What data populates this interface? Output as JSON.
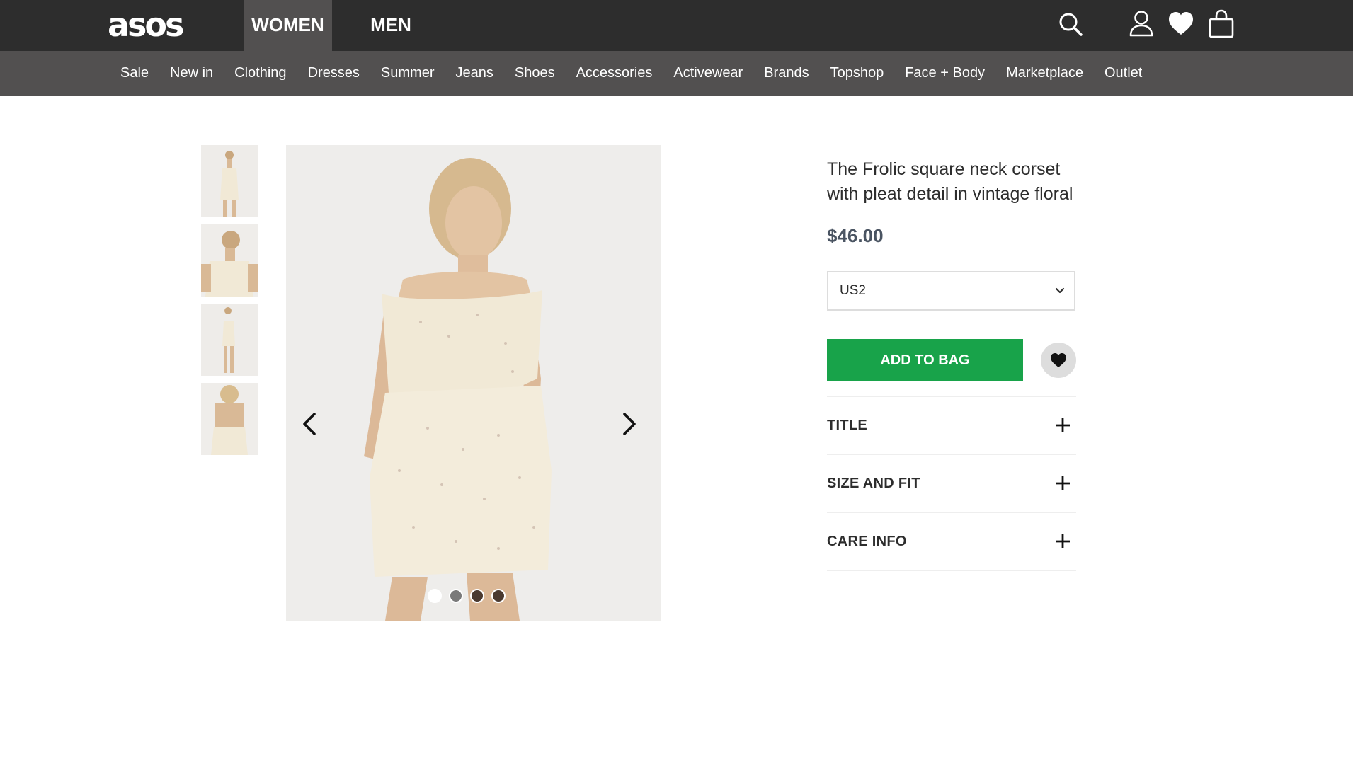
{
  "header": {
    "logo_text": "asos",
    "gender_tabs": [
      {
        "label": "WOMEN",
        "active": true
      },
      {
        "label": "MEN",
        "active": false
      }
    ],
    "icons": [
      "search-icon",
      "account-icon",
      "saved-items-icon",
      "bag-icon"
    ]
  },
  "category_nav": {
    "items": [
      "Sale",
      "New in",
      "Clothing",
      "Dresses",
      "Summer",
      "Jeans",
      "Shoes",
      "Accessories",
      "Activewear",
      "Brands",
      "Topshop",
      "Face + Body",
      "Marketplace",
      "Outlet"
    ]
  },
  "gallery": {
    "thumbnail_count": 4,
    "dots": {
      "count": 4,
      "active_index": 0
    }
  },
  "product": {
    "title": "The Frolic square neck corset with pleat detail in vintage floral",
    "price": "$46.00",
    "size_selected": "US2",
    "add_to_bag_label": "ADD TO BAG",
    "accordion": [
      {
        "label": "TITLE"
      },
      {
        "label": "SIZE AND FIT"
      },
      {
        "label": "CARE INFO"
      }
    ]
  },
  "colors": {
    "topbar": "#2d2d2d",
    "nav": "#525050",
    "add_to_bag": "#18a34a",
    "price": "#4a5462"
  }
}
